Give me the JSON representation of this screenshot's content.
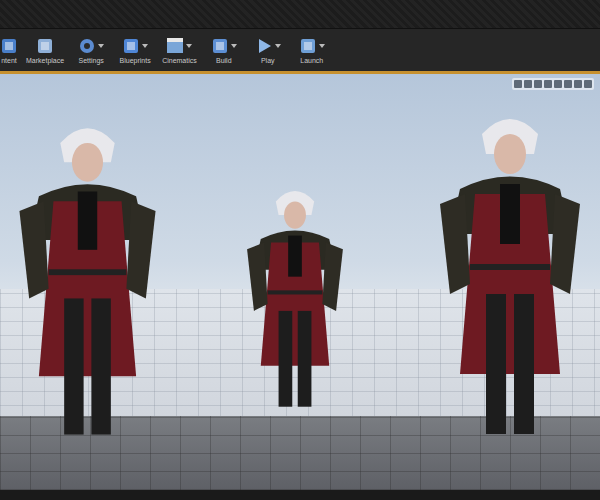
{
  "toolbar": {
    "buttons": [
      {
        "label": "ntent",
        "has_menu": false
      },
      {
        "label": "Marketplace",
        "has_menu": false
      },
      {
        "label": "Settings",
        "has_menu": true
      },
      {
        "label": "Blueprints",
        "has_menu": true
      },
      {
        "label": "Cinematics",
        "has_menu": true
      },
      {
        "label": "Build",
        "has_menu": true
      },
      {
        "label": "Play",
        "has_menu": true
      },
      {
        "label": "Launch",
        "has_menu": true
      }
    ]
  },
  "viewport": {
    "controls": 8
  }
}
